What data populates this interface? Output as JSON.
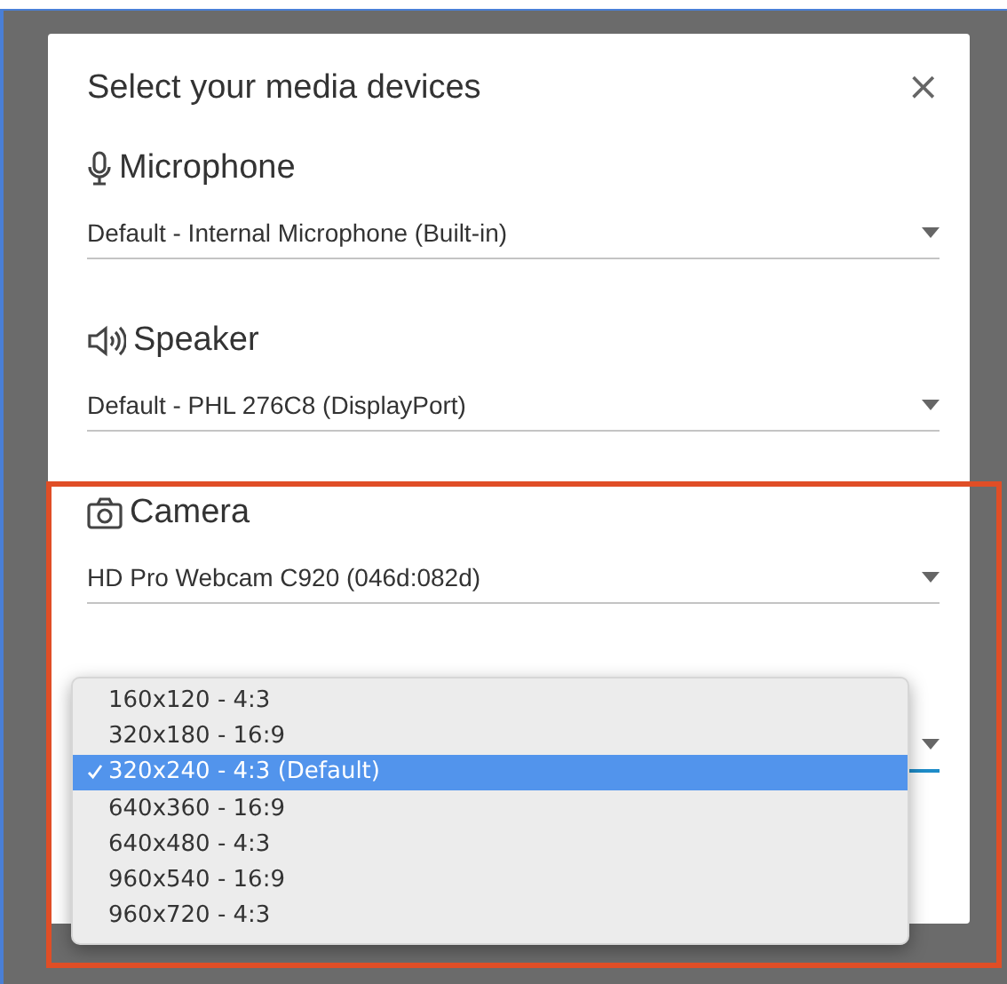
{
  "dialog": {
    "title": "Select your media devices",
    "close": "×"
  },
  "devices": [
    {
      "kind": "microphone",
      "label": "Microphone",
      "value": "Default - Internal Microphone (Built-in)"
    },
    {
      "kind": "speaker",
      "label": "Speaker",
      "value": "Default - PHL 276C8 (DisplayPort)"
    },
    {
      "kind": "camera",
      "label": "Camera",
      "value": "HD Pro Webcam C920 (046d:082d)"
    }
  ],
  "resolution_menu": {
    "open": true,
    "options": [
      {
        "label": "160x120 - 4:3",
        "selected": false
      },
      {
        "label": "320x180 - 16:9",
        "selected": false
      },
      {
        "label": "320x240 - 4:3 (Default)",
        "selected": true
      },
      {
        "label": "640x360 - 16:9",
        "selected": false
      },
      {
        "label": "640x480 - 4:3",
        "selected": false
      },
      {
        "label": "960x540 - 16:9",
        "selected": false
      },
      {
        "label": "960x720 - 4:3",
        "selected": false
      }
    ]
  }
}
